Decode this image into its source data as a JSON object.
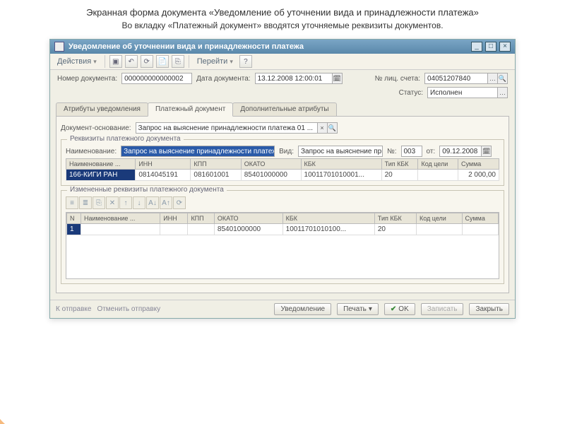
{
  "page": {
    "title": "Экранная форма документа «Уведомление об уточнении вида и принадлежности платежа»",
    "subtitle": "Во вкладку «Платежный документ»  вводятся уточняемые реквизиты документов."
  },
  "window": {
    "title": "Уведомление об уточнении вида и принадлежности платежа"
  },
  "menubar": {
    "actions": "Действия",
    "goto": "Перейти"
  },
  "header": {
    "doc_number_label": "Номер документа:",
    "doc_number": "000000000000002",
    "doc_date_label": "Дата документа:",
    "doc_date": "13.12.2008 12:00:01",
    "account_label": "№ лиц. счета:",
    "account": "04051207840",
    "status_label": "Статус:",
    "status": "Исполнен"
  },
  "tabs": {
    "t1": "Атрибуты уведомления",
    "t2": "Платежный документ",
    "t3": "Дополнительные атрибуты"
  },
  "body": {
    "basis_label": "Документ-основание:",
    "basis": "Запрос на выяснение принадлежности платежа 01 ...",
    "fieldset1_title": "Реквизиты платежного документа",
    "name_label": "Наименование:",
    "name": "Запрос на выяснение принадлежности платежа",
    "kind_label": "Вид:",
    "kind": "Запрос на выяснение при...",
    "num_label": "№:",
    "num": "003",
    "from_label": "от:",
    "from": "09.12.2008",
    "fieldset2_title": "Измененные реквизиты платежного документа"
  },
  "grid1": {
    "cols": [
      "Наименование ...",
      "ИНН",
      "КПП",
      "ОКАТО",
      "КБК",
      "Тип КБК",
      "Код цели",
      "Сумма"
    ],
    "row": [
      "166-КИГИ РАН",
      "0814045191",
      "081601001",
      "85401000000",
      "10011701010001...",
      "20",
      "",
      "2 000,00"
    ]
  },
  "grid2": {
    "cols": [
      "N",
      "Наименование ...",
      "ИНН",
      "КПП",
      "ОКАТО",
      "КБК",
      "Тип КБК",
      "Код цели",
      "Сумма"
    ],
    "row": [
      "1",
      "",
      "",
      "",
      "85401000000",
      "10011701010100...",
      "20",
      "",
      ""
    ]
  },
  "bottom": {
    "send": "К отправке",
    "cancel_send": "Отменить отправку",
    "notify": "Уведомление",
    "print": "Печать",
    "ok": "OK",
    "save": "Записать",
    "close": "Закрыть"
  }
}
